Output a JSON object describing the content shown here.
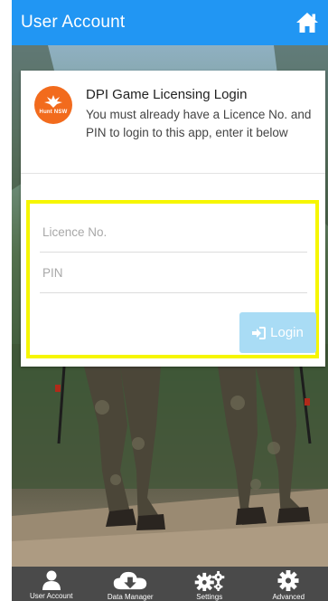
{
  "header": {
    "title": "User Account",
    "home_icon": "home-icon"
  },
  "card": {
    "logo": {
      "icon": "nsw-waratah-icon",
      "text": "Hunt NSW",
      "color": "#f26b1d"
    },
    "title": "DPI Game Licensing Login",
    "description": "You must already have a Licence No. and PIN to login to this app, enter it below"
  },
  "form": {
    "licence_placeholder": "Licence No.",
    "pin_placeholder": "PIN",
    "login_label": "Login",
    "login_icon": "sign-in-icon",
    "highlight_color": "#f6f600"
  },
  "tabs": [
    {
      "label": "User Account",
      "icon": "user-icon"
    },
    {
      "label": "Data Manager",
      "icon": "cloud-download-icon"
    },
    {
      "label": "Settings",
      "icon": "cogs-icon"
    },
    {
      "label": "Advanced",
      "icon": "cog-icon"
    }
  ],
  "colors": {
    "accent": "#2196f3",
    "tabbar": "#4a4a4a",
    "login_button": "#a9dcf5"
  }
}
